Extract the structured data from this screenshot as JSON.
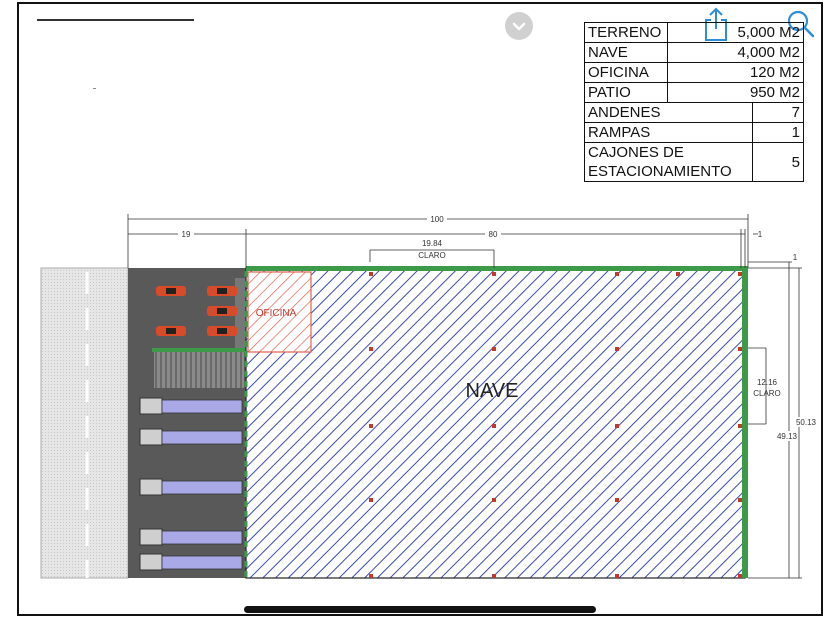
{
  "spec_table": [
    {
      "label": "TERRENO",
      "value": "5,000 M2"
    },
    {
      "label": "NAVE",
      "value": "4,000 M2"
    },
    {
      "label": "OFICINA",
      "value": "120 M2"
    },
    {
      "label": "PATIO",
      "value": "950 M2"
    },
    {
      "label": "ANDENES",
      "value": "7"
    },
    {
      "label": "RAMPAS",
      "value": "1"
    },
    {
      "label": "CAJONES DE ESTACIONAMIENTO",
      "value": "5"
    }
  ],
  "plan": {
    "nave_label": "NAVE",
    "oficina_label": "OFICINA",
    "dim_total_width": "100",
    "dim_patio_width": "19",
    "dim_nave_width": "80",
    "dim_side_width": "1",
    "dim_right_offset": "1",
    "claro_h_value": "19.84",
    "claro_h_label": "CLARO",
    "claro_v_value": "12.16",
    "claro_v_label": "CLARO",
    "depth_total": "50.13",
    "depth_nave": "49.13"
  },
  "icons": [
    "chevron-down-icon",
    "share-icon",
    "search-icon"
  ],
  "colors": {
    "nave_hatch": "#3a4bb0",
    "oficina_hatch": "#e06050",
    "border_green": "#3c9a48",
    "patio": "#595959",
    "truck": "#a9a9e8",
    "car": "#d84a28",
    "icon_blue": "#2d8ed8"
  }
}
